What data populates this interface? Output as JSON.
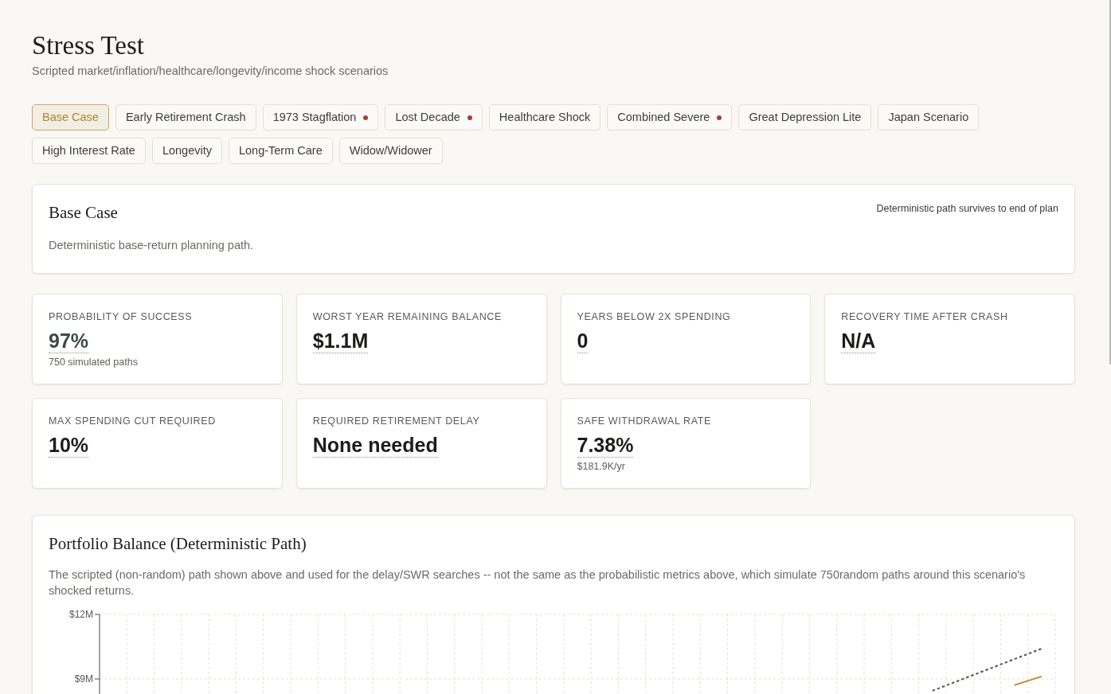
{
  "header": {
    "title": "Stress Test",
    "subtitle": "Scripted market/inflation/healthcare/longevity/income shock scenarios"
  },
  "scenario_tabs": [
    {
      "label": "Base Case",
      "selected": true,
      "flagged": false
    },
    {
      "label": "Early Retirement Crash",
      "selected": false,
      "flagged": false
    },
    {
      "label": "1973 Stagflation",
      "selected": false,
      "flagged": true
    },
    {
      "label": "Lost Decade",
      "selected": false,
      "flagged": true
    },
    {
      "label": "Healthcare Shock",
      "selected": false,
      "flagged": false
    },
    {
      "label": "Combined Severe",
      "selected": false,
      "flagged": true
    },
    {
      "label": "Great Depression Lite",
      "selected": false,
      "flagged": false
    },
    {
      "label": "Japan Scenario",
      "selected": false,
      "flagged": false
    },
    {
      "label": "High Interest Rate",
      "selected": false,
      "flagged": false
    },
    {
      "label": "Longevity",
      "selected": false,
      "flagged": false
    },
    {
      "label": "Long-Term Care",
      "selected": false,
      "flagged": false
    },
    {
      "label": "Widow/Widower",
      "selected": false,
      "flagged": false
    }
  ],
  "scenario_card": {
    "title": "Base Case",
    "status": "Deterministic path survives to end of plan",
    "description": "Deterministic base-return planning path."
  },
  "metrics": [
    {
      "label": "PROBABILITY OF SUCCESS",
      "value": "97%",
      "note": "750 simulated paths",
      "color": "#3e4a43"
    },
    {
      "label": "WORST YEAR REMAINING BALANCE",
      "value": "$1.1M",
      "color": "#1c1c1a"
    },
    {
      "label": "YEARS BELOW 2X SPENDING",
      "value": "0",
      "color": "#1c1c1a"
    },
    {
      "label": "RECOVERY TIME AFTER CRASH",
      "value": "N/A",
      "color": "#1c1c1a"
    },
    {
      "label": "MAX SPENDING CUT REQUIRED",
      "value": "10%",
      "color": "#1c1c1a"
    },
    {
      "label": "REQUIRED RETIREMENT DELAY",
      "value": "None needed",
      "color": "#1c1c1a"
    },
    {
      "label": "SAFE WITHDRAWAL RATE",
      "value": "7.38%",
      "note": "$181.9K/yr",
      "color": "#1c1c1a"
    }
  ],
  "portfolio_chart": {
    "title": "Portfolio Balance (Deterministic Path)",
    "description": "The scripted (non-random) path shown above and used for the delay/SWR searches -- not the same as the probabilistic metrics above, which simulate 750random paths around this scenario's shocked returns.",
    "chart_data": {
      "type": "line",
      "grid": true,
      "categories": [
        null,
        null,
        null,
        null,
        null,
        null,
        null,
        null,
        null,
        null,
        null,
        null,
        null,
        null,
        null,
        null,
        null,
        null,
        null,
        null,
        null,
        null,
        null,
        null,
        null,
        null,
        null,
        null,
        null,
        null,
        null,
        null,
        null,
        null,
        null
      ],
      "ylim": [
        8.3,
        12
      ],
      "yticks": [
        {
          "value": 12,
          "label": "$12M"
        },
        {
          "value": 9,
          "label": "$9M"
        }
      ],
      "series": [
        {
          "color": "#555555",
          "line_style": "dashed",
          "values": [
            null,
            null,
            null,
            null,
            null,
            null,
            null,
            null,
            null,
            null,
            null,
            null,
            null,
            null,
            null,
            null,
            null,
            null,
            null,
            null,
            null,
            null,
            null,
            null,
            null,
            null,
            null,
            null,
            null,
            null,
            8.45,
            8.94,
            9.43,
            9.92,
            10.41
          ]
        },
        {
          "color": "#b8892f",
          "line_style": "solid",
          "values": [
            null,
            null,
            null,
            null,
            null,
            null,
            null,
            null,
            null,
            null,
            null,
            null,
            null,
            null,
            null,
            null,
            null,
            null,
            null,
            null,
            null,
            null,
            null,
            null,
            null,
            null,
            null,
            null,
            null,
            null,
            null,
            null,
            null,
            8.71,
            9.12
          ]
        }
      ]
    }
  }
}
